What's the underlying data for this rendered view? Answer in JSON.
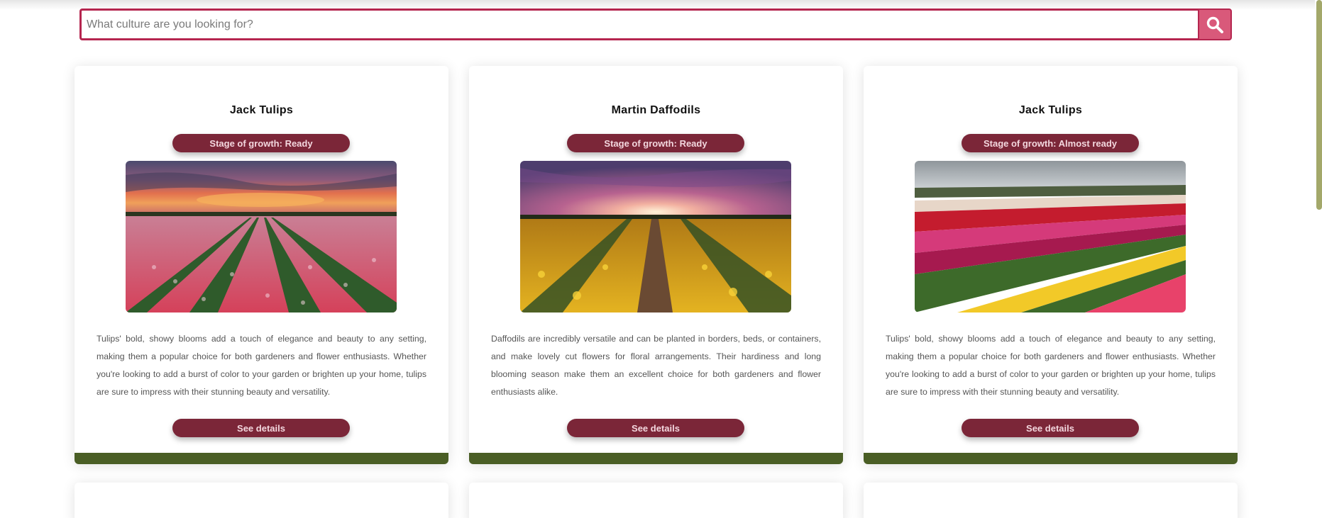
{
  "search": {
    "placeholder": "What culture are you looking for?",
    "button_icon": "search-icon"
  },
  "colors": {
    "accent": "#b5264f",
    "badge_bg": "#7b2638",
    "search_button": "#d9597a",
    "card_footer": "#4a5e25",
    "scrollbar": "#a3a86a"
  },
  "cards": [
    {
      "title": "Jack Tulips",
      "stage": "Stage of growth: Ready",
      "image": "pink tulip field at sunset",
      "description": "Tulips' bold, showy blooms add a touch of elegance and beauty to any setting, making them a popular choice for both gardeners and flower enthusiasts. Whether you're looking to add a burst of color to your garden or brighten up your home, tulips are sure to impress with their stunning beauty and versatility.",
      "button": "See details"
    },
    {
      "title": "Martin Daffodils",
      "stage": "Stage of growth: Ready",
      "image": "yellow daffodil field at sunset",
      "description": "Daffodils are incredibly versatile and can be planted in borders, beds, or containers, and make lovely cut flowers for floral arrangements. Their hardiness and long blooming season make them an excellent choice for both gardeners and flower enthusiasts alike.",
      "button": "See details"
    },
    {
      "title": "Jack Tulips",
      "stage": "Stage of growth: Almost ready",
      "image": "striped multicolor tulip field",
      "description": "Tulips' bold, showy blooms add a touch of elegance and beauty to any setting, making them a popular choice for both gardeners and flower enthusiasts. Whether you're looking to add a burst of color to your garden or brighten up your home, tulips are sure to impress with their stunning beauty and versatility.",
      "button": "See details"
    }
  ]
}
